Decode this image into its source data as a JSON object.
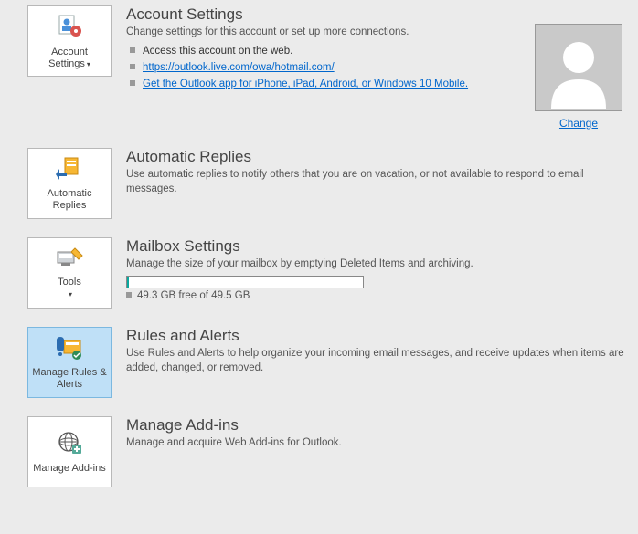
{
  "sections": {
    "account": {
      "tile": "Account Settings",
      "title": "Account Settings",
      "desc": "Change settings for this account or set up more connections.",
      "bullets": [
        "Access this account on the web.",
        "https://outlook.live.com/owa/hotmail.com/",
        "Get the Outlook app for iPhone, iPad, Android, or Windows 10 Mobile."
      ],
      "avatar_change": "Change"
    },
    "replies": {
      "tile": "Automatic Replies",
      "title": "Automatic Replies",
      "desc": "Use automatic replies to notify others that you are on vacation, or not available to respond to email messages."
    },
    "mailbox": {
      "tile": "Tools",
      "title": "Mailbox Settings",
      "desc": "Manage the size of your mailbox by emptying Deleted Items and archiving.",
      "status": "49.3 GB free of 49.5 GB"
    },
    "rules": {
      "tile": "Manage Rules & Alerts",
      "title": "Rules and Alerts",
      "desc": "Use Rules and Alerts to help organize your incoming email messages, and receive updates when items are added, changed, or removed."
    },
    "addins": {
      "tile": "Manage Add-ins",
      "title": "Manage Add-ins",
      "desc": "Manage and acquire Web Add-ins for Outlook."
    }
  }
}
